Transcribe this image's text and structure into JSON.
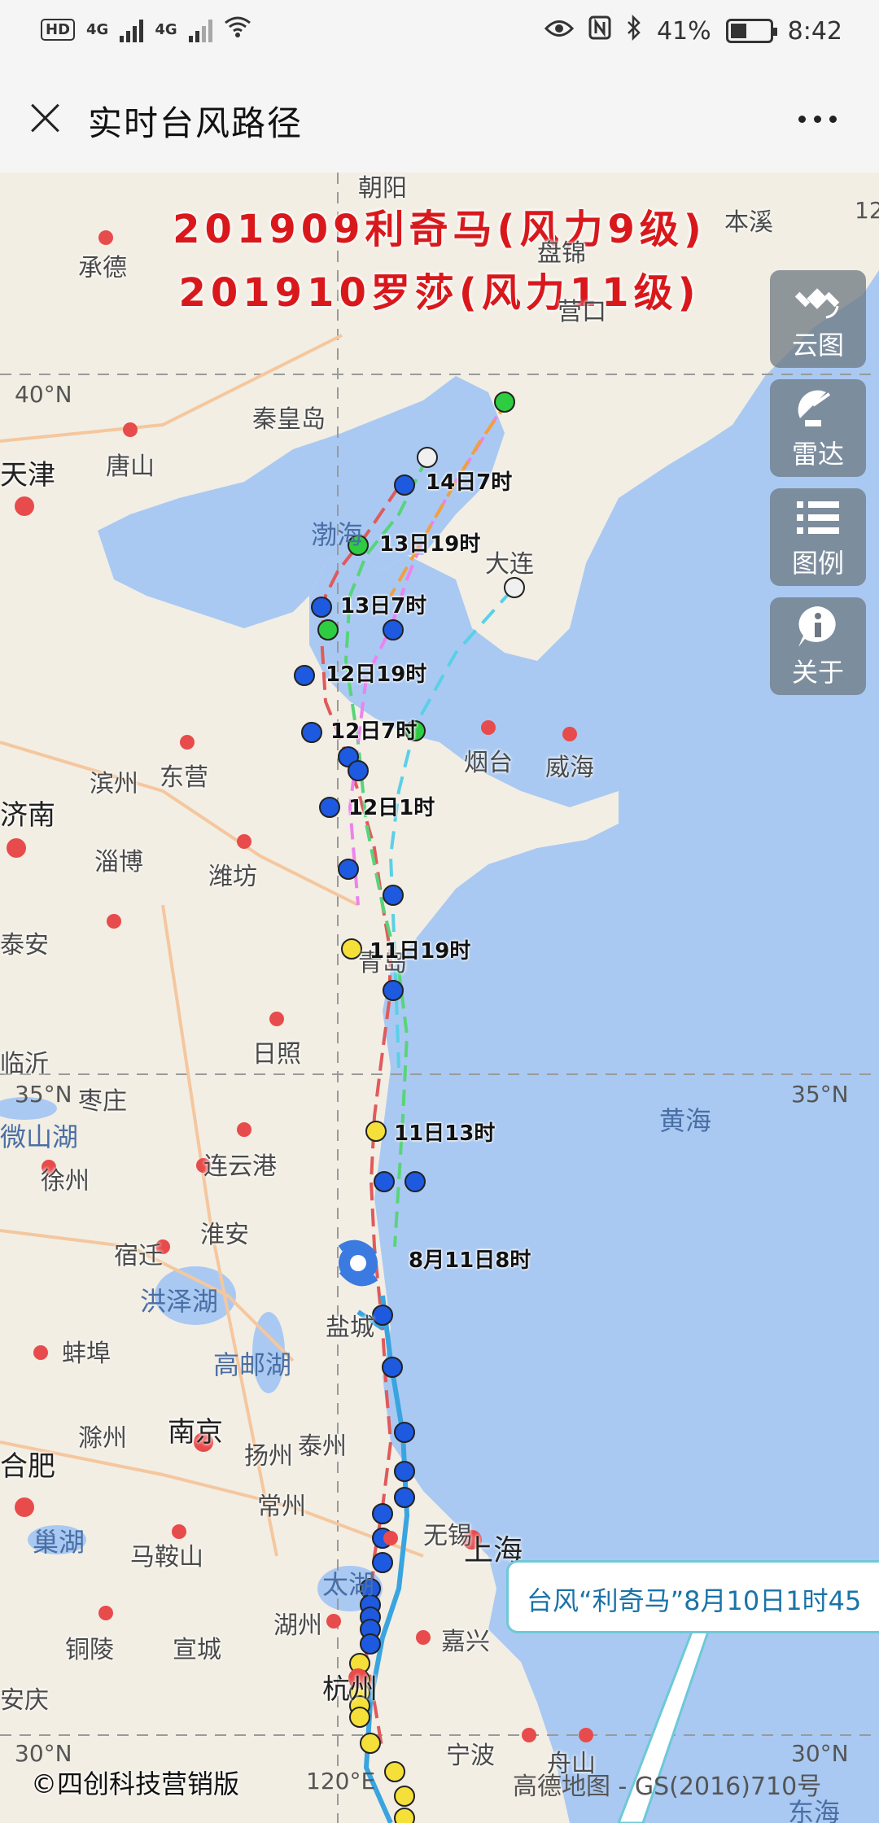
{
  "status_bar": {
    "network_a": "4G",
    "network_b": "4G",
    "battery_percent": "41%",
    "battery_level": 0.41,
    "time": "8:42"
  },
  "header": {
    "title": "实时台风路径"
  },
  "map": {
    "title_line1": "201909利奇马(风力9级)",
    "title_line2": "201910罗莎(风力11级)",
    "side_buttons": [
      {
        "label": "云图",
        "icon": "satellite-icon"
      },
      {
        "label": "雷达",
        "icon": "radar-icon"
      },
      {
        "label": "图例",
        "icon": "legend-icon"
      },
      {
        "label": "关于",
        "icon": "info-icon"
      }
    ],
    "places": [
      "朝阳",
      "本溪",
      "承德",
      "盘锦",
      "营口",
      "秦皇岛",
      "天津",
      "唐山",
      "渤海",
      "大连",
      "滨州",
      "东营",
      "济南",
      "烟台",
      "威海",
      "淄博",
      "潍坊",
      "泰安",
      "青岛",
      "日照",
      "枣庄",
      "临沂",
      "微山湖",
      "徐州",
      "连云港",
      "黄海",
      "宿迁",
      "淮安",
      "洪泽湖",
      "盐城",
      "蚌埠",
      "高邮湖",
      "滁州",
      "扬州",
      "泰州",
      "南京",
      "合肥",
      "常州",
      "无锡",
      "上海",
      "巢湖",
      "马鞍山",
      "太湖",
      "湖州",
      "嘉兴",
      "铜陵",
      "宣城",
      "杭州",
      "安庆",
      "宁波",
      "舟山",
      "东海"
    ],
    "coords": [
      "40°N",
      "35°N",
      "35°N",
      "30°N",
      "30°N",
      "120°E",
      "12"
    ],
    "track_labels": [
      "14日7时",
      "13日19时",
      "13日7时",
      "12日19时",
      "12日7时",
      "12日1时",
      "11日19时",
      "11日13时",
      "8月11日8时"
    ],
    "callout": "台风“利奇马”8月10日1时45",
    "copyright": "©四创科技营销版",
    "attribution": "高德地图 - GS(2016)710号"
  }
}
